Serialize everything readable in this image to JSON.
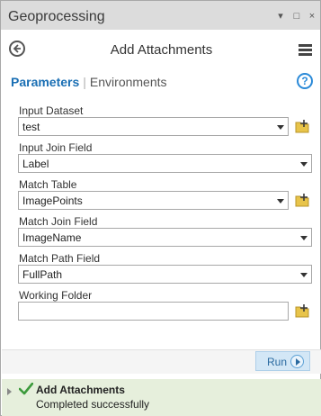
{
  "window": {
    "title": "Geoprocessing",
    "pin_glyph": "▾",
    "max_glyph": "□",
    "close_glyph": "×"
  },
  "header": {
    "title": "Add Attachments",
    "back_icon": "back-arrow-icon",
    "menu_icon": "hamburger-menu-icon"
  },
  "tabs": {
    "active": "Parameters",
    "separator": "|",
    "other": "Environments",
    "help_glyph": "?"
  },
  "parameters": [
    {
      "label": "Input Dataset",
      "value": "test",
      "browse": true
    },
    {
      "label": "Input Join Field",
      "value": "Label",
      "browse": false
    },
    {
      "label": "Match Table",
      "value": "ImagePoints",
      "browse": true
    },
    {
      "label": "Match Join Field",
      "value": "ImageName",
      "browse": false
    },
    {
      "label": "Match Path Field",
      "value": "FullPath",
      "browse": false
    },
    {
      "label": "Working Folder",
      "value": "",
      "browse": true
    }
  ],
  "run": {
    "label": "Run"
  },
  "status": {
    "title": "Add Attachments",
    "message": "Completed successfully",
    "color": "#3c9a3c"
  }
}
